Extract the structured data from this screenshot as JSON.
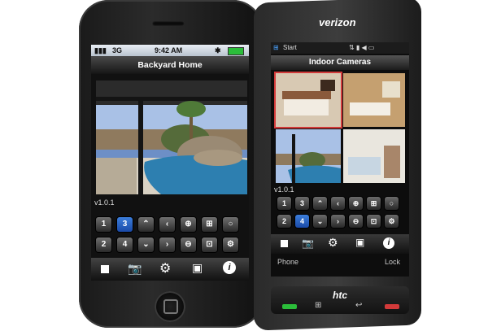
{
  "iphone": {
    "status": {
      "carrier": "3G",
      "time": "9:42 AM"
    },
    "title": "Backyard Home",
    "version": "v1.0.1",
    "keypad": [
      "1",
      "3",
      "",
      "",
      "",
      "",
      "",
      "2",
      "4",
      "",
      "",
      "",
      "",
      ""
    ],
    "toolbar_icons": [
      "stop-icon",
      "camera-icon",
      "gear-icon",
      "screenshot-icon",
      "info-icon"
    ]
  },
  "htc": {
    "brand_top": "verizon",
    "status": {
      "start": "Start"
    },
    "title": "Indoor Cameras",
    "version": "v1.0.1",
    "keypad": [
      "1",
      "3",
      "",
      "",
      "",
      "",
      "",
      "2",
      "4",
      "",
      "",
      "",
      "",
      ""
    ],
    "softkeys": {
      "left": "Phone",
      "right": "Lock"
    },
    "brand_bottom": "htc"
  },
  "colors": {
    "accent": "#2a64c8",
    "highlight": "#d23a3a"
  }
}
